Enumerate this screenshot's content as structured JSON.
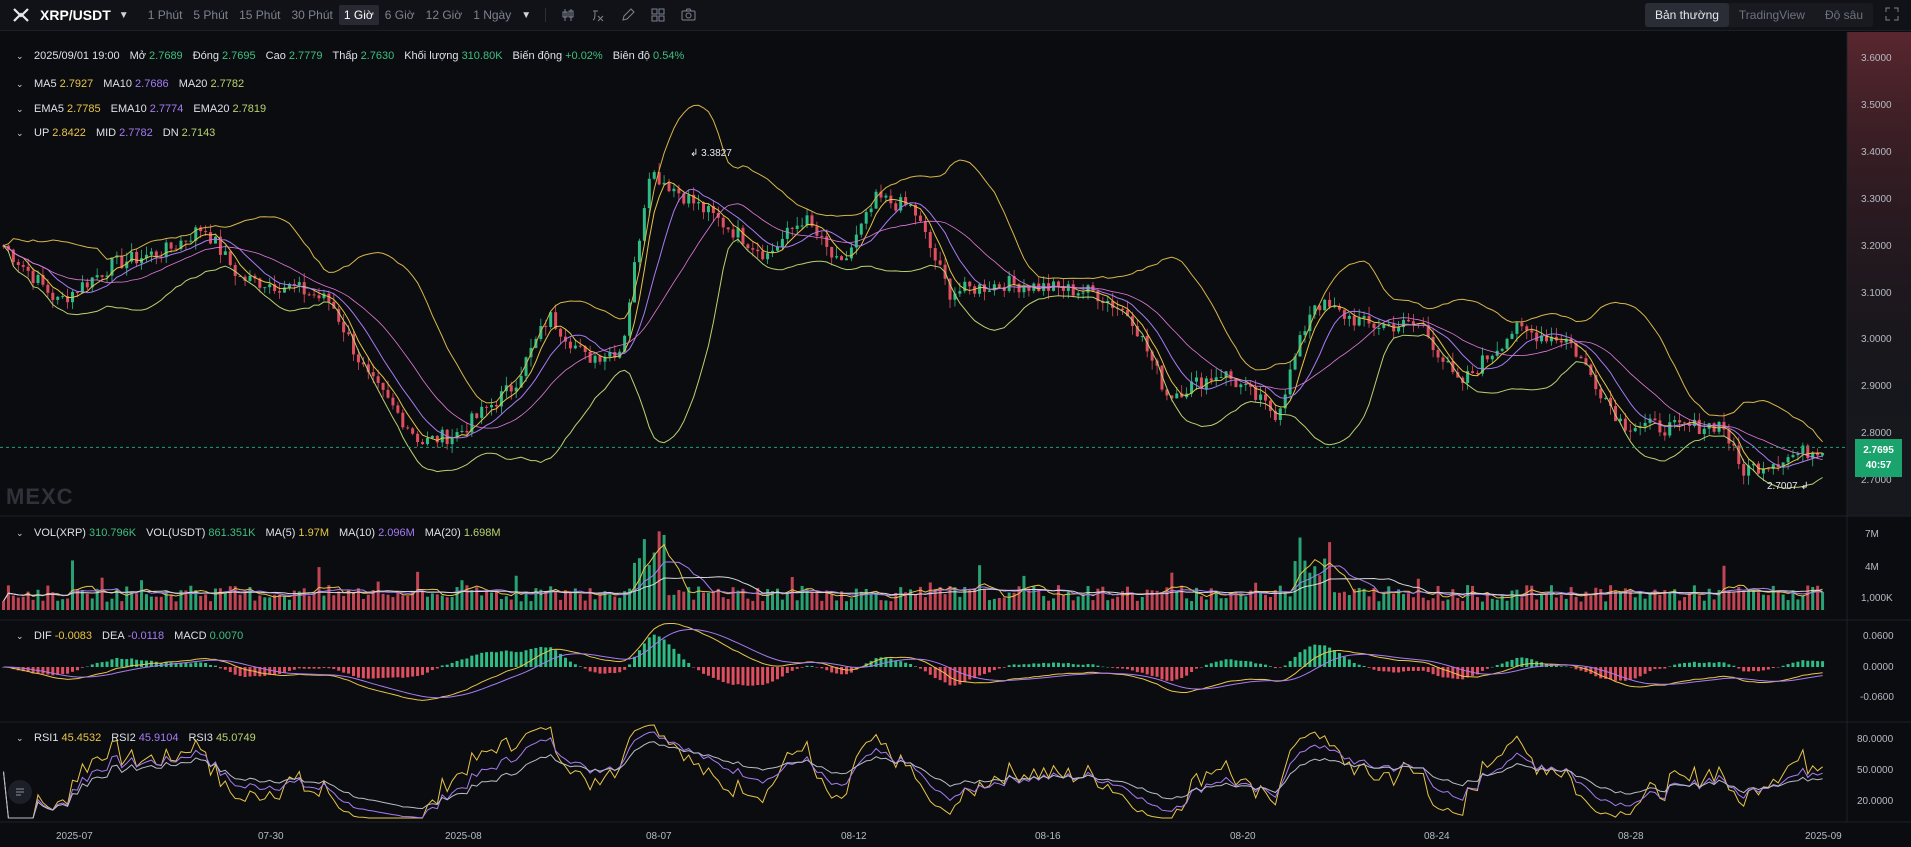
{
  "toolbar": {
    "pair": "XRP/USDT",
    "timeframes": [
      "1 Phút",
      "5 Phút",
      "15 Phút",
      "30 Phút",
      "1 Giờ",
      "6 Giờ",
      "12 Giờ",
      "1 Ngày"
    ],
    "active_timeframe": "1 Giờ",
    "views": [
      "Bản thường",
      "TradingView",
      "Độ sâu"
    ],
    "active_view": "Bản thường",
    "icons": [
      "candle-type-icon",
      "indicator-icon",
      "draw-icon",
      "layout-icon",
      "camera-icon"
    ]
  },
  "ohlc": {
    "datetime": "2025/09/01 19:00",
    "open_label": "Mở",
    "open": "2.7689",
    "close_label": "Đóng",
    "close": "2.7695",
    "high_label": "Cao",
    "high": "2.7779",
    "low_label": "Thấp",
    "low": "2.7630",
    "volume_label": "Khối lượng",
    "volume": "310.80K",
    "change_label": "Biến động",
    "change": "+0.02%",
    "amp_label": "Biên độ",
    "amp": "0.54%"
  },
  "ma": {
    "ma5_label": "MA5",
    "ma5": "2.7927",
    "ma10_label": "MA10",
    "ma10": "2.7686",
    "ma20_label": "MA20",
    "ma20": "2.7782"
  },
  "ema": {
    "ema5_label": "EMA5",
    "ema5": "2.7785",
    "ema10_label": "EMA10",
    "ema10": "2.7774",
    "ema20_label": "EMA20",
    "ema20": "2.7819"
  },
  "boll": {
    "up_label": "UP",
    "up": "2.8422",
    "mid_label": "MID",
    "mid": "2.7782",
    "dn_label": "DN",
    "dn": "2.7143"
  },
  "vol": {
    "xrp_label": "VOL(XRP)",
    "xrp": "310.796K",
    "usdt_label": "VOL(USDT)",
    "usdt": "861.351K",
    "ma5_label": "MA(5)",
    "ma5": "1.97M",
    "ma10_label": "MA(10)",
    "ma10": "2.096M",
    "ma20_label": "MA(20)",
    "ma20": "1.698M"
  },
  "macd": {
    "dif_label": "DIF",
    "dif": "-0.0083",
    "dea_label": "DEA",
    "dea": "-0.0118",
    "macd_label": "MACD",
    "macd": "0.0070"
  },
  "rsi": {
    "rsi1_label": "RSI1",
    "rsi1": "45.4532",
    "rsi2_label": "RSI2",
    "rsi2": "45.9104",
    "rsi3_label": "RSI3",
    "rsi3": "45.0749"
  },
  "price_axis": [
    "3.6000",
    "3.5000",
    "3.4000",
    "3.3000",
    "3.2000",
    "3.1000",
    "3.0000",
    "2.9000",
    "2.8000",
    "2.7000"
  ],
  "vol_axis": [
    "7M",
    "4M",
    "1,000K"
  ],
  "macd_axis": [
    "0.0600",
    "0.0000",
    "-0.0600"
  ],
  "rsi_axis": [
    "80.0000",
    "50.0000",
    "20.0000"
  ],
  "x_axis": [
    "2025-07",
    "07-30",
    "2025-08",
    "08-07",
    "08-12",
    "08-16",
    "08-20",
    "08-24",
    "08-28",
    "2025-09"
  ],
  "current_price": "2.7695",
  "countdown": "40:57",
  "high_marker": "3.3827",
  "low_marker": "2.7007",
  "watermark": "MEXC",
  "colors": {
    "up": "#2ebd85",
    "down": "#e04f5f",
    "ma5": "#e8c547",
    "ma10": "#a67cf2",
    "ma20": "#b8d370",
    "boll": "#d8b64a"
  }
}
